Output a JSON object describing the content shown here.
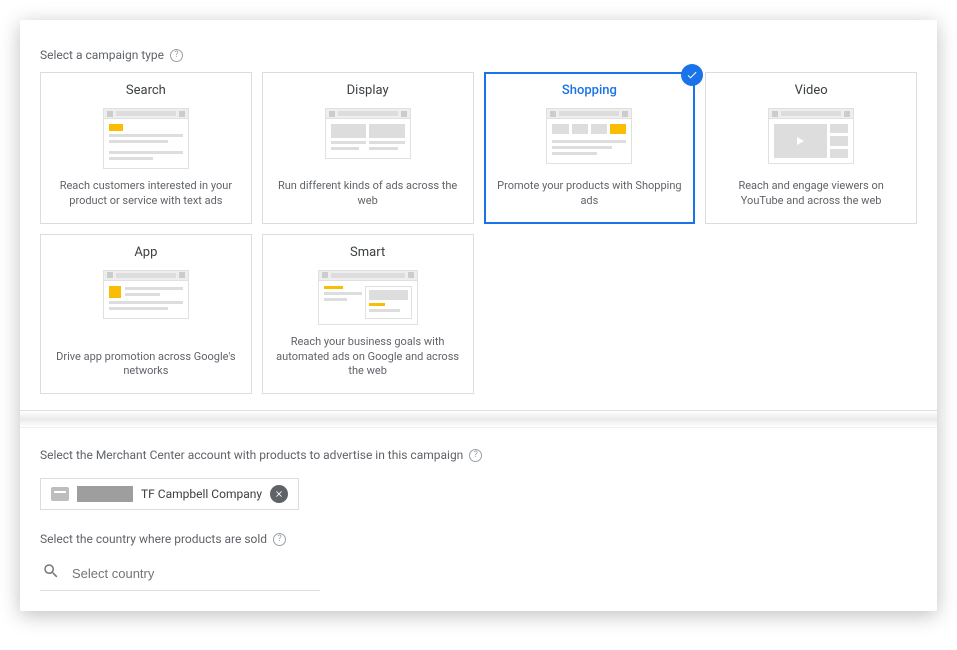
{
  "campaign_label": "Select a campaign type",
  "tiles": {
    "search": {
      "title": "Search",
      "desc": "Reach customers interested in your product or service with text ads"
    },
    "display": {
      "title": "Display",
      "desc": "Run different kinds of ads across the web"
    },
    "shopping": {
      "title": "Shopping",
      "desc": "Promote your products with Shopping ads"
    },
    "video": {
      "title": "Video",
      "desc": "Reach and engage viewers on YouTube and across the web"
    },
    "app": {
      "title": "App",
      "desc": "Drive app promotion across Google's networks"
    },
    "smart": {
      "title": "Smart",
      "desc": "Reach your business goals with automated ads on Google and across the web"
    }
  },
  "merchant": {
    "label": "Select the Merchant Center account with products to advertise in this campaign",
    "name": "TF Campbell Company"
  },
  "country": {
    "label": "Select the country where products are sold",
    "placeholder": "Select country"
  }
}
